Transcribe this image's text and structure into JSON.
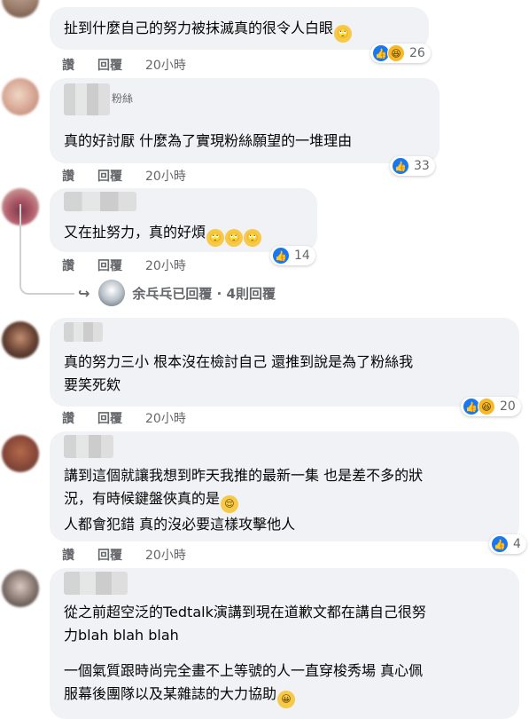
{
  "comments": [
    {
      "text_lines": [
        "扯到什麼自己的努力被抹滅真的很令人白眼"
      ],
      "emoji_after": "🙄",
      "actions": {
        "like": "讚",
        "reply": "回覆",
        "time": "20小時"
      },
      "reactions": {
        "types": [
          "like",
          "haha"
        ],
        "count": "26"
      }
    },
    {
      "name_suffix": "粉絲",
      "text_lines": [
        "真的好討厭 什麼為了實現粉絲願望的一堆理由"
      ],
      "actions": {
        "like": "讚",
        "reply": "回覆",
        "time": "20小時"
      },
      "reactions": {
        "types": [
          "like"
        ],
        "count": "33"
      }
    },
    {
      "text_lines": [
        "又在扯努力，真的好煩"
      ],
      "emoji_after": "🙄🙄🙄",
      "actions": {
        "like": "讚",
        "reply": "回覆",
        "time": "20小時"
      },
      "reactions": {
        "types": [
          "like"
        ],
        "count": "14"
      },
      "replies_summary": "余乓乓已回覆 · 4則回覆"
    },
    {
      "text_lines": [
        "真的努力三小 根本沒在檢討自己 還推到說是為了粉絲我",
        "要笑死欸"
      ],
      "actions": {
        "like": "讚",
        "reply": "回覆",
        "time": "20小時"
      },
      "reactions": {
        "types": [
          "like",
          "haha"
        ],
        "count": "20"
      }
    },
    {
      "text_lines": [
        "講到這個就讓我想到昨天我推的最新一集 也是差不多的狀",
        "況，有時候鍵盤俠真的是",
        "人都會犯錯 真的沒必要這樣攻擊他人"
      ],
      "emoji_inline": "😌",
      "actions": {
        "like": "讚",
        "reply": "回覆",
        "time": "20小時"
      },
      "reactions": {
        "types": [
          "like"
        ],
        "count": "4"
      }
    },
    {
      "text_lines": [
        "從之前超空泛的Tedtalk演講到現在道歉文都在講自己很努",
        "力blah blah blah",
        "一個氣質跟時尚完全畫不上等號的人一直穿梭秀場 真心佩",
        "服幕後團隊以及某雜誌的大力協助"
      ],
      "emoji_after": "😀"
    }
  ]
}
